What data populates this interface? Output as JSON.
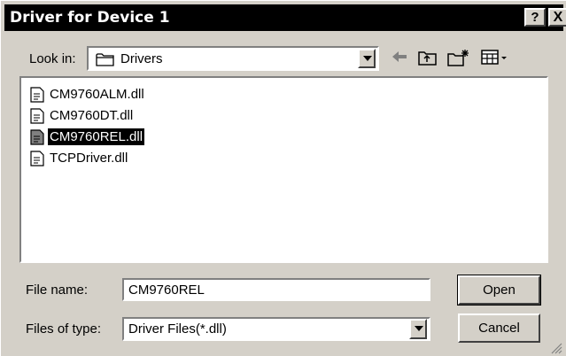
{
  "window": {
    "title": "Driver for Device 1",
    "help_label": "?",
    "close_label": "X"
  },
  "lookin": {
    "label": "Look in:",
    "value": "Drivers"
  },
  "toolbar": {
    "icons": [
      "back-arrow-icon",
      "up-folder-icon",
      "new-folder-icon",
      "view-menu-icon"
    ]
  },
  "files": [
    {
      "name": "CM9760ALM.dll",
      "selected": false
    },
    {
      "name": "CM9760DT.dll",
      "selected": false
    },
    {
      "name": "CM9760REL.dll",
      "selected": true
    },
    {
      "name": "TCPDriver.dll",
      "selected": false
    }
  ],
  "filename": {
    "label": "File name:",
    "value": "CM9760REL"
  },
  "filetype": {
    "label": "Files of type:",
    "value": "Driver Files(*.dll)"
  },
  "buttons": {
    "open": "Open",
    "cancel": "Cancel"
  }
}
